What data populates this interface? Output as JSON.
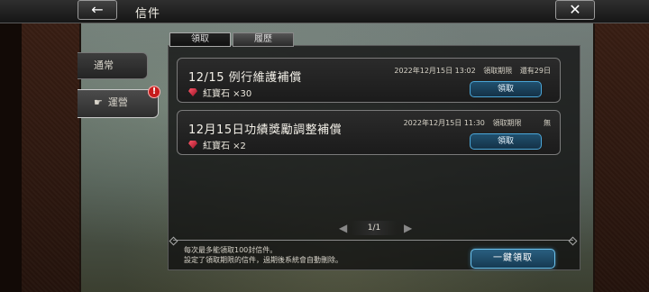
{
  "header": {
    "title": "信件",
    "back_icon": "arrow-left-icon",
    "close_icon": "close-x-icon"
  },
  "sidebar": {
    "items": [
      {
        "label": "通常"
      },
      {
        "label": "運營",
        "icon": "pointing-hand-icon",
        "alert": "!"
      }
    ]
  },
  "tabs": [
    {
      "label": "領取"
    },
    {
      "label": "履歷"
    }
  ],
  "mails": [
    {
      "title": "12/15 例行維護補償",
      "date": "2022年12月15日 13:02",
      "deadline_label": "領取期限",
      "deadline_value": "還有29日",
      "reward": "紅寶石 ×30",
      "claim_label": "領取",
      "reward_icon": "ruby-gem-icon"
    },
    {
      "title": "12月15日功績獎勵調整補償",
      "date": "2022年12月15日 11:30",
      "deadline_label": "領取期限",
      "deadline_value": "無",
      "reward": "紅寶石 ×2",
      "claim_label": "領取",
      "reward_icon": "ruby-gem-icon"
    }
  ],
  "pager": {
    "text": "1/1"
  },
  "footer": {
    "note_line1": "每次最多能領取100封信件。",
    "note_line2": "設定了領取期限的信件，過期後系統會自動刪除。",
    "claim_all_label": "一鍵領取"
  },
  "colors": {
    "button_accent": "#4aa6d8",
    "alert": "#c61c1c",
    "gem": "#e0304a"
  }
}
